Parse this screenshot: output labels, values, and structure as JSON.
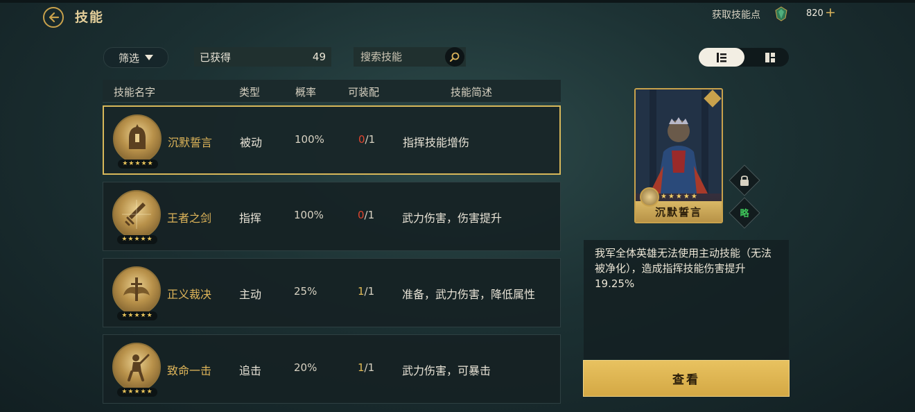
{
  "header": {
    "title": "技能",
    "skill_points_label": "获取技能点",
    "skill_points_value": "820",
    "plus_symbol": "+"
  },
  "toolbar": {
    "filter_label": "筛选",
    "obtained_label": "已获得",
    "obtained_count": "49",
    "search_placeholder": "搜索技能"
  },
  "table": {
    "columns": [
      "技能名字",
      "类型",
      "概率",
      "可装配",
      "技能简述"
    ],
    "rows": [
      {
        "name": "沉默誓言",
        "type": "被动",
        "rate": "100%",
        "equip_current": "0",
        "equip_total": "/1",
        "desc": "指挥技能增伤",
        "stars": "★★★★★",
        "icon": "knight-helmet-icon",
        "selected": true
      },
      {
        "name": "王者之剑",
        "type": "指挥",
        "rate": "100%",
        "equip_current": "0",
        "equip_total": "/1",
        "desc": "武力伤害，伤害提升",
        "stars": "★★★★★",
        "icon": "glowing-sword-icon",
        "selected": false
      },
      {
        "name": "正义裁决",
        "type": "主动",
        "rate": "25%",
        "equip_current": "1",
        "equip_total": "/1",
        "desc": "准备，武力伤害，降低属性",
        "stars": "★★★★★",
        "icon": "winged-sword-icon",
        "selected": false
      },
      {
        "name": "致命一击",
        "type": "追击",
        "rate": "20%",
        "equip_current": "1",
        "equip_total": "/1",
        "desc": "武力伤害，可暴击",
        "stars": "★★★★★",
        "icon": "warrior-strike-icon",
        "selected": false
      }
    ]
  },
  "detail": {
    "card_name": "沉默誓言",
    "card_stars": "★★★★★",
    "strategy_label": "略",
    "description": "我军全体英雄无法使用主动技能（无法被净化），造成指挥技能伤害提升19.25%",
    "view_button": "查看"
  },
  "colors": {
    "gold": "#c9a24c",
    "name_gold": "#e0b65a",
    "equip_red": "#e0452f",
    "equip_yellow": "#e2bb55",
    "strategy_green": "#3ec85a",
    "button_gold": "#d4a844"
  }
}
